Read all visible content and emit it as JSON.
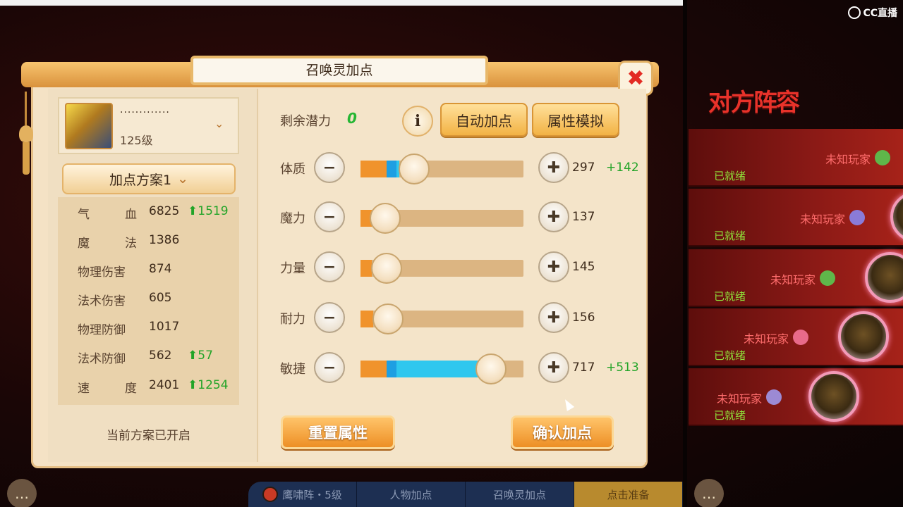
{
  "brand": {
    "logo_text": "CC直播"
  },
  "dialog": {
    "title": "召唤灵加点",
    "close_symbol": "✖",
    "pet": {
      "name": "·············",
      "level": "125级",
      "avatar_icon": "summoned-beast-avatar",
      "dropdown_symbol": "⌄"
    },
    "scheme": {
      "label": "加点方案1",
      "chevron": "⌄",
      "status": "当前方案已开启"
    },
    "stats": [
      {
        "label_a": "气",
        "label_b": "血",
        "value": "6825",
        "bonus": "1519"
      },
      {
        "label_a": "魔",
        "label_b": "法",
        "value": "1386",
        "bonus": ""
      },
      {
        "label_a": "物理伤害",
        "label_b": "",
        "value": "874",
        "bonus": ""
      },
      {
        "label_a": "法术伤害",
        "label_b": "",
        "value": "605",
        "bonus": ""
      },
      {
        "label_a": "物理防御",
        "label_b": "",
        "value": "1017",
        "bonus": ""
      },
      {
        "label_a": "法术防御",
        "label_b": "",
        "value": "562",
        "bonus": "57"
      },
      {
        "label_a": "速",
        "label_b": "度",
        "value": "2401",
        "bonus": "1254"
      }
    ],
    "remaining": {
      "label": "剩余潜力",
      "value": "0"
    },
    "info_symbol": "i",
    "auto_btn": "自动加点",
    "simulate_btn": "属性模拟",
    "minus_symbol": "−",
    "plus_symbol": "✚",
    "attributes": [
      {
        "label": "体质",
        "value": "297",
        "bonus": "+142",
        "base_fraction": 0.16,
        "added_fraction": 0.08,
        "knob_fraction": 0.33
      },
      {
        "label": "魔力",
        "value": "137",
        "bonus": "",
        "base_fraction": 0.07,
        "added_fraction": 0.0,
        "knob_fraction": 0.15
      },
      {
        "label": "力量",
        "value": "145",
        "bonus": "",
        "base_fraction": 0.07,
        "added_fraction": 0.0,
        "knob_fraction": 0.16
      },
      {
        "label": "耐力",
        "value": "156",
        "bonus": "",
        "base_fraction": 0.08,
        "added_fraction": 0.0,
        "knob_fraction": 0.17
      },
      {
        "label": "敏捷",
        "value": "717",
        "bonus": "+513",
        "base_fraction": 0.16,
        "added_fraction": 0.64,
        "knob_fraction": 0.8
      }
    ],
    "reset_btn": "重置属性",
    "confirm_btn": "确认加点",
    "bonus_arrow": "⬆"
  },
  "opponent": {
    "title": "对方阵容",
    "players": [
      {
        "name": "未知玩家",
        "status": "已就绪",
        "badge_color": "#5fb64a"
      },
      {
        "name": "未知玩家",
        "status": "已就绪",
        "badge_color": "#8a7bd8"
      },
      {
        "name": "未知玩家",
        "status": "已就绪",
        "badge_color": "#5fb64a"
      },
      {
        "name": "未知玩家",
        "status": "已就绪",
        "badge_color": "#e86a8a"
      },
      {
        "name": "未知玩家",
        "status": "已就绪",
        "badge_color": "#9c8ad4"
      }
    ]
  },
  "bottom_bar": {
    "formation": "鹰啸阵・5级",
    "char_points": "人物加点",
    "pet_points": "召唤灵加点",
    "ready": "点击准备"
  },
  "chat_icon": "chat-bubble-icon",
  "colors": {
    "accent": "#f2b244",
    "bonus_green": "#22a428",
    "slider_blue": "#2fc7ee",
    "slider_orange": "#f0932c"
  }
}
